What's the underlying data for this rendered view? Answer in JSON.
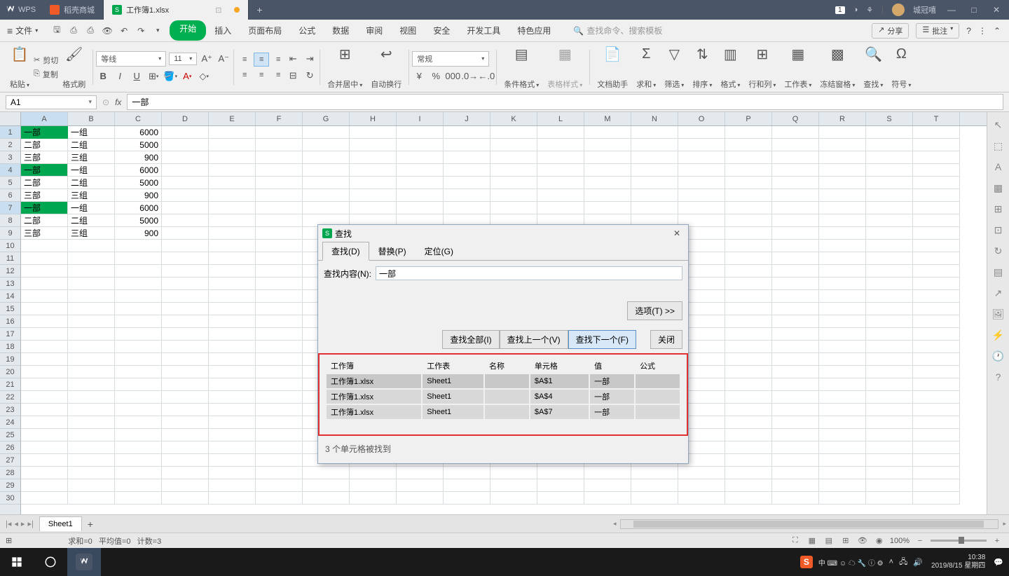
{
  "titlebar": {
    "app": "WPS",
    "tabs": [
      {
        "label": "稻壳商城",
        "type": "shop"
      },
      {
        "label": "工作簿1.xlsx",
        "type": "doc",
        "active": true
      }
    ],
    "user": "城冠嘻",
    "badge": "1"
  },
  "menubar": {
    "file": "文件",
    "tabs": [
      "开始",
      "插入",
      "页面布局",
      "公式",
      "数据",
      "审阅",
      "视图",
      "安全",
      "开发工具",
      "特色应用"
    ],
    "active": 0,
    "search_placeholder": "查找命令、搜索模板",
    "share": "分享",
    "annotate": "批注"
  },
  "ribbon": {
    "paste": "粘贴",
    "cut": "剪切",
    "copy": "复制",
    "format_painter": "格式刷",
    "font_name": "等线",
    "font_size": "11",
    "merge": "合并居中",
    "wrap": "自动换行",
    "number_format": "常规",
    "cond_fmt": "条件格式",
    "table_fmt": "表格样式",
    "doc_helper": "文档助手",
    "sum": "求和",
    "filter": "筛选",
    "sort": "排序",
    "format": "格式",
    "rowcol": "行和列",
    "worksheet": "工作表",
    "freeze": "冻结窗格",
    "find": "查找",
    "symbol": "符号"
  },
  "formula": {
    "name": "A1",
    "value": "一部"
  },
  "columns": [
    "A",
    "B",
    "C",
    "D",
    "E",
    "F",
    "G",
    "H",
    "I",
    "J",
    "K",
    "L",
    "M",
    "N",
    "O",
    "P",
    "Q",
    "R",
    "S",
    "T"
  ],
  "data_rows": [
    [
      "一部",
      "一组",
      "6000"
    ],
    [
      "二部",
      "二组",
      "5000"
    ],
    [
      "三部",
      "三组",
      "900"
    ],
    [
      "一部",
      "一组",
      "6000"
    ],
    [
      "二部",
      "二组",
      "5000"
    ],
    [
      "三部",
      "三组",
      "900"
    ],
    [
      "一部",
      "一组",
      "6000"
    ],
    [
      "二部",
      "二组",
      "5000"
    ],
    [
      "三部",
      "三组",
      "900"
    ]
  ],
  "highlighted_rows": [
    0,
    3,
    6
  ],
  "sheet": {
    "name": "Sheet1"
  },
  "statusbar": {
    "sum": "求和=0",
    "avg": "平均值=0",
    "count": "计数=3",
    "zoom": "100%"
  },
  "dialog": {
    "title": "查找",
    "tabs": {
      "find": "查找(D)",
      "replace": "替换(P)",
      "goto": "定位(G)"
    },
    "find_label": "查找内容(N):",
    "find_value": "一部",
    "options": "选项(T) >>",
    "find_all": "查找全部(I)",
    "find_prev": "查找上一个(V)",
    "find_next": "查找下一个(F)",
    "close": "关闭",
    "headers": {
      "workbook": "工作簿",
      "sheet": "工作表",
      "name": "名称",
      "cell": "单元格",
      "value": "值",
      "formula": "公式"
    },
    "results": [
      {
        "wb": "工作簿1.xlsx",
        "sh": "Sheet1",
        "nm": "",
        "cell": "$A$1",
        "val": "一部",
        "fm": ""
      },
      {
        "wb": "工作簿1.xlsx",
        "sh": "Sheet1",
        "nm": "",
        "cell": "$A$4",
        "val": "一部",
        "fm": ""
      },
      {
        "wb": "工作簿1.xlsx",
        "sh": "Sheet1",
        "nm": "",
        "cell": "$A$7",
        "val": "一部",
        "fm": ""
      }
    ],
    "status": "3 个单元格被找到"
  },
  "taskbar": {
    "time": "10:38",
    "date": "2019/8/15 星期四"
  }
}
